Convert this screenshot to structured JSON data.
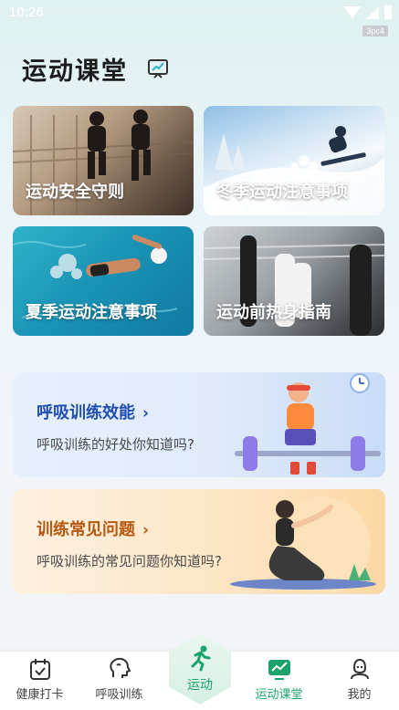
{
  "status_bar": {
    "time": "10:26",
    "device_tag": "3pc4"
  },
  "header": {
    "title": "运动课堂"
  },
  "cards": [
    {
      "label": "运动安全守则"
    },
    {
      "label": "冬季运动注意事项"
    },
    {
      "label": "夏季运动注意事项"
    },
    {
      "label": "运动前热身指南"
    }
  ],
  "banners": [
    {
      "title": "呼吸训练效能",
      "subtitle": "呼吸训练的好处你知道吗?"
    },
    {
      "title": "训练常见问题",
      "subtitle": "呼吸训练的常见问题你知道吗?"
    }
  ],
  "bottom_nav": {
    "items": [
      {
        "label": "健康打卡",
        "icon": "checkin-icon"
      },
      {
        "label": "呼吸训练",
        "icon": "head-breath-icon"
      },
      {
        "label": "运动",
        "icon": "running-icon"
      },
      {
        "label": "运动课堂",
        "icon": "chart-board-icon"
      },
      {
        "label": "我的",
        "icon": "profile-icon"
      }
    ],
    "active_index": 3
  },
  "colors": {
    "accent": "#1ba36b",
    "banner1_title": "#1f4fb0",
    "banner2_title": "#b8580f"
  }
}
